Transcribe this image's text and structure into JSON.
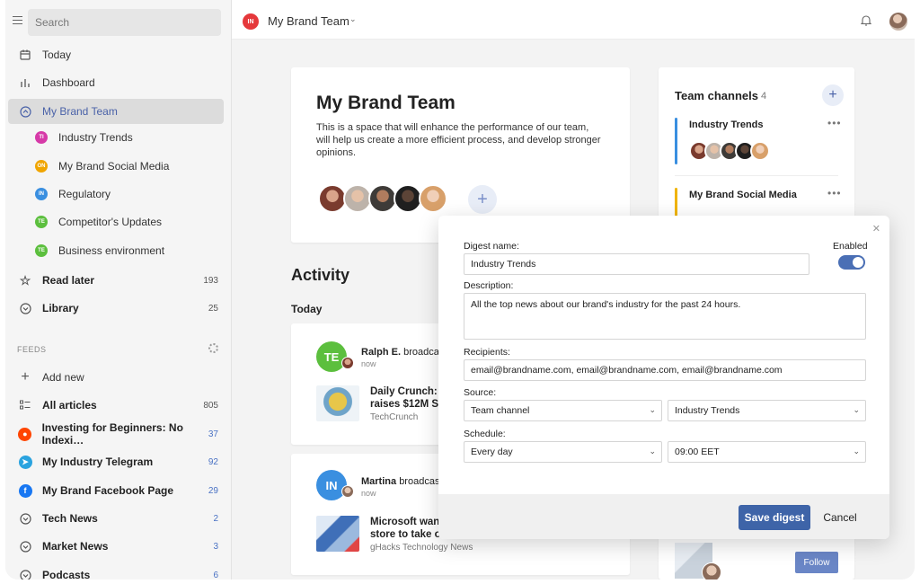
{
  "search": {
    "placeholder": "Search"
  },
  "sidebar": {
    "items": [
      {
        "label": "Today",
        "icon": "calendar-icon"
      },
      {
        "label": "Dashboard",
        "icon": "bar-chart-icon"
      },
      {
        "label": "My Brand Team",
        "icon": "chevron-circle-icon"
      }
    ],
    "channels": [
      {
        "label": "Industry Trends",
        "badge": "TI",
        "color": "#d63aa8"
      },
      {
        "label": "My Brand Social Media",
        "badge": "ON",
        "color": "#f0a500"
      },
      {
        "label": "Regulatory",
        "badge": "IN",
        "color": "#3a8fe0"
      },
      {
        "label": "Competitor's Updates",
        "badge": "TE",
        "color": "#5cbf3e"
      },
      {
        "label": "Business environment",
        "badge": "TE",
        "color": "#5cbf3e"
      }
    ],
    "read_later": {
      "label": "Read later",
      "count": "193"
    },
    "library": {
      "label": "Library",
      "count": "25"
    },
    "feeds_header": "FEEDS",
    "add_new": "Add new",
    "feeds": [
      {
        "label": "All articles",
        "count": "805"
      },
      {
        "label": "Investing for Beginners: No Indexi…",
        "count": "37",
        "icon": "reddit-icon",
        "color": "#ff4500"
      },
      {
        "label": "My Industry Telegram",
        "count": "92",
        "icon": "telegram-icon",
        "color": "#2aa3df"
      },
      {
        "label": "My Brand Facebook Page",
        "count": "29",
        "icon": "facebook-icon",
        "color": "#1877f2"
      },
      {
        "label": "Tech News",
        "count": "2"
      },
      {
        "label": "Market News",
        "count": "3"
      },
      {
        "label": "Podcasts",
        "count": "6"
      }
    ]
  },
  "header": {
    "badge": "IN",
    "title": "My Brand Team"
  },
  "team": {
    "title": "My Brand Team",
    "description": "This is a space that will enhance the performance of our team, will help us create a more efficient process, and develop stronger opinions."
  },
  "activity": {
    "title": "Activity",
    "today": "Today",
    "posts": [
      {
        "initials": "TE",
        "color": "#5cbf3e",
        "name": "Ralph E.",
        "verb": "broadcas",
        "time": "now",
        "headline": "Daily Crunch: F raises $12M Se",
        "source": "TechCrunch"
      },
      {
        "initials": "IN",
        "color": "#3a8fe0",
        "name": "Martina",
        "verb": "broadcas",
        "time": "now",
        "headline": "Microsoft wan store to take o",
        "source": "gHacks Technology News"
      }
    ]
  },
  "team_channels": {
    "title": "Team channels",
    "count": "4",
    "channels": [
      {
        "name": "Industry Trends",
        "color": "#3a8fe0"
      },
      {
        "name": "My Brand Social Media",
        "color": "#f0b400"
      }
    ]
  },
  "digest": {
    "name_label": "Digest name:",
    "name_value": "Industry Trends",
    "enabled_label": "Enabled",
    "description_label": "Description:",
    "description_value": "All the top news about our brand's industry for the past 24 hours.",
    "recipients_label": "Recipients:",
    "recipients_value": "email@brandname.com, email@brandname.com, email@brandname.com",
    "source_label": "Source:",
    "source_type": "Team channel",
    "source_value": "Industry Trends",
    "schedule_label": "Schedule:",
    "schedule_frequency": "Every day",
    "schedule_time": "09:00 EET",
    "save_label": "Save digest",
    "cancel_label": "Cancel"
  },
  "follow_label": "Follow"
}
